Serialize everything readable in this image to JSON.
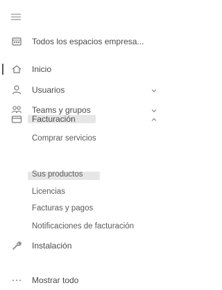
{
  "nav": {
    "workspace": "Todos los espacios empresa...",
    "items": [
      {
        "label": "Inicio"
      },
      {
        "label": "Usuarios"
      },
      {
        "label": "Teams y grupos"
      },
      {
        "label": "Facturación"
      },
      {
        "label": "Instalación"
      },
      {
        "label": "Mostrar todo"
      }
    ],
    "billing_sub": [
      {
        "label": "Comprar servicios"
      },
      {
        "label": "Sus productos"
      },
      {
        "label": "Licencias"
      },
      {
        "label": "Facturas y pagos"
      },
      {
        "label": "Notificaciones de facturación"
      }
    ]
  },
  "icons": {
    "menu": "hamburger-icon",
    "workspace": "building-icon",
    "home": "home-icon",
    "users": "user-icon",
    "teams": "people-icon",
    "billing": "card-icon",
    "setup": "wrench-icon",
    "more": "ellipsis-icon"
  }
}
